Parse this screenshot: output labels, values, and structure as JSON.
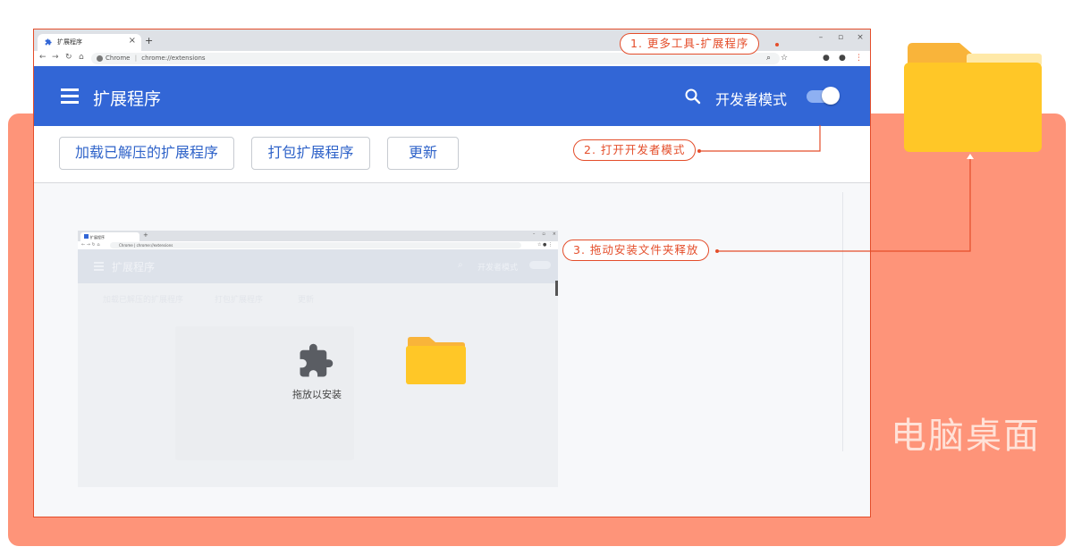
{
  "desktop": {
    "label": "电脑桌面",
    "bg_color": "#fe9479"
  },
  "browser": {
    "tab": {
      "title": "扩展程序",
      "close": "×"
    },
    "new_tab": "+",
    "window_controls": [
      "–",
      "▫",
      "×"
    ],
    "address": {
      "origin": "Chrome",
      "separator": "|",
      "url": "chrome://extensions"
    },
    "app_bar": {
      "title": "扩展程序",
      "dev_mode_label": "开发者模式",
      "dev_mode_on": true,
      "accent": "#3266d6"
    },
    "actions": {
      "load_unpacked": "加载已解压的扩展程序",
      "pack": "打包扩展程序",
      "update": "更新"
    }
  },
  "inner_screenshot": {
    "tab_title": "扩展程序",
    "address": {
      "origin": "Chrome",
      "separator": "|",
      "url": "chrome://extensions"
    },
    "app_title": "扩展程序",
    "dev_mode_label": "开发者模式",
    "actions": {
      "load_unpacked": "加载已解压的扩展程序",
      "pack": "打包扩展程序",
      "update": "更新"
    },
    "drop_label": "拖放以安装"
  },
  "annotations": {
    "step1": "1. 更多工具-扩展程序",
    "step2": "2. 打开开发者模式",
    "step3": "3. 拖动安装文件夹释放",
    "color": "#e44d2a"
  }
}
